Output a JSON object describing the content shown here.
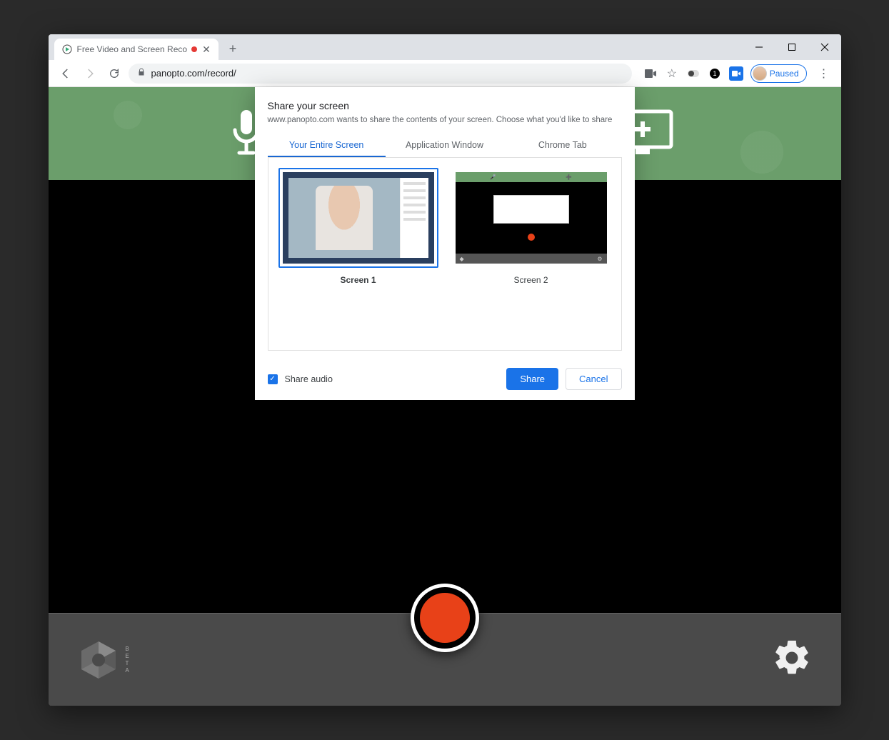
{
  "browser": {
    "tab_title": "Free Video and Screen Reco",
    "url": "panopto.com/record/",
    "profile_status": "Paused"
  },
  "modal": {
    "title": "Share your screen",
    "description": "www.panopto.com wants to share the contents of your screen. Choose what you'd like to share.",
    "tabs": {
      "entire_screen": "Your Entire Screen",
      "app_window": "Application Window",
      "chrome_tab": "Chrome Tab"
    },
    "screens": {
      "screen1": "Screen 1",
      "screen2": "Screen 2"
    },
    "share_audio_label": "Share audio",
    "share_button": "Share",
    "cancel_button": "Cancel"
  },
  "app": {
    "beta_badge": "BETA"
  }
}
